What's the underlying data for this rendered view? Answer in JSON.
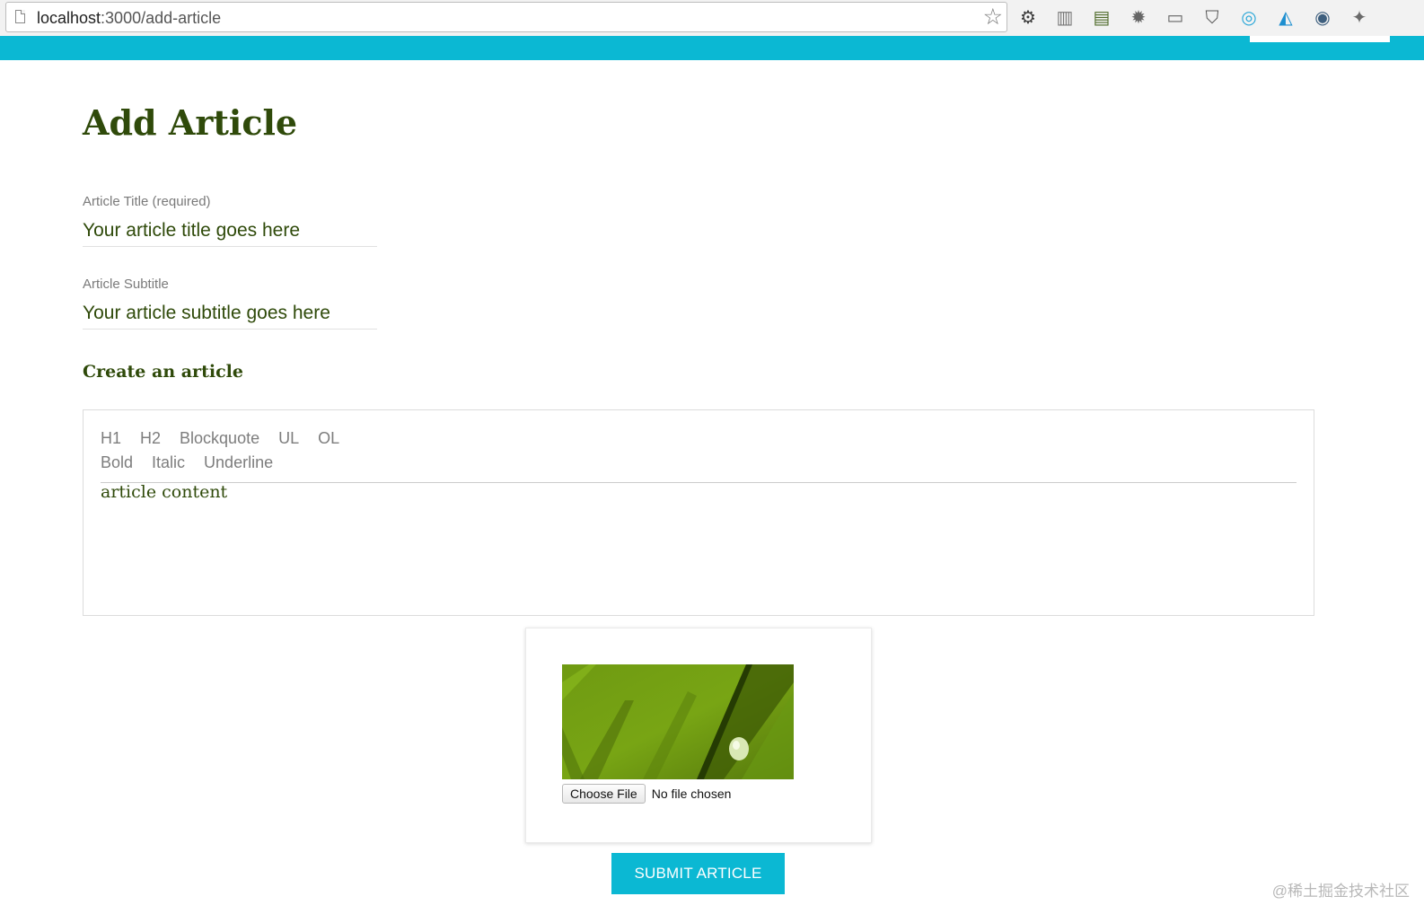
{
  "browser": {
    "url_host": "localhost",
    "url_path": ":3000/add-article",
    "extensions": [
      {
        "name": "gear-icon",
        "glyph": "⚙",
        "color": "#3a3a3a"
      },
      {
        "name": "px-ruler-icon",
        "glyph": "▥",
        "color": "#777777"
      },
      {
        "name": "film-icon",
        "glyph": "▤",
        "color": "#4f6b2a"
      },
      {
        "name": "bug-icon",
        "glyph": "✹",
        "color": "#666666"
      },
      {
        "name": "new-badge-icon",
        "glyph": "▭",
        "color": "#666666"
      },
      {
        "name": "pocket-icon",
        "glyph": "⛉",
        "color": "#555555"
      },
      {
        "name": "globe-blue-icon",
        "glyph": "◎",
        "color": "#2aa7d8"
      },
      {
        "name": "triangle-icon",
        "glyph": "◭",
        "color": "#1e8fd0"
      },
      {
        "name": "world-icon",
        "glyph": "◉",
        "color": "#3e5f7e"
      },
      {
        "name": "pin-icon",
        "glyph": "✦",
        "color": "#6a6a6a"
      }
    ]
  },
  "theme": {
    "accent": "#0bb8d3",
    "text_green": "#2f4a0a"
  },
  "page": {
    "title": "Add Article",
    "article_title_label": "Article Title (required)",
    "article_title_placeholder": "Your article title goes here",
    "article_subtitle_label": "Article Subtitle",
    "article_subtitle_placeholder": "Your article subtitle goes here",
    "editor_heading": "Create an article"
  },
  "editor": {
    "toolbar_row1": [
      "H1",
      "H2",
      "Blockquote",
      "UL",
      "OL"
    ],
    "toolbar_row2": [
      "Bold",
      "Italic",
      "Underline"
    ],
    "content": "article content"
  },
  "upload": {
    "choose_file_label": "Choose File",
    "file_status": "No file chosen"
  },
  "submit_label": "SUBMIT ARTICLE",
  "watermark": "@稀土掘金技术社区"
}
